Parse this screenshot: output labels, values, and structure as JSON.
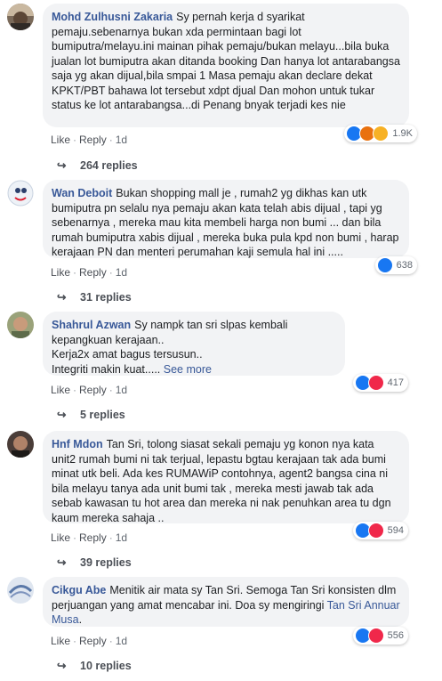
{
  "actions": {
    "like": "Like",
    "reply": "Reply",
    "time": "1d",
    "sep": "·"
  },
  "comments": [
    {
      "author": "Mohd Zulhusni Zakaria",
      "text": "Sy pernah kerja d syarikat pemaju.sebenarnya bukan xda permintaan bagi lot bumiputra/melayu.ini mainan pihak pemaju/bukan melayu...bila buka jualan lot bumiputra akan ditanda booking Dan hanya lot antarabangsa saja yg akan dijual,bila smpai 1 Masa pemaju akan declare dekat KPKT/PBT bahawa lot tersebut xdpt djual Dan mohon untuk tukar status ke lot antarabangsa...di Penang bnyak terjadi kes nie",
      "reactions": [
        "like-icon",
        "angry-icon",
        "wow-icon"
      ],
      "reaction_count": "1.9K",
      "replies": "264 replies"
    },
    {
      "author": "Wan Deboit",
      "text": "Bukan shopping mall je , rumah2 yg dikhas kan utk bumiputra pn selalu nya pemaju akan kata telah abis dijual , tapi yg sebenarnya , mereka mau kita membeli harga non bumi ... dan bila rumah bumiputra xabis dijual , mereka buka pula kpd non bumi , harap kerajaan PN dan menteri perumahan kaji semula hal ini .....",
      "reactions": [
        "like-icon"
      ],
      "reaction_count": "638",
      "replies": "31 replies"
    },
    {
      "author": "Shahrul Azwan",
      "text": "Sy nampk tan sri slpas kembali kepangkuan kerajaan..",
      "line2": "Kerja2x amat bagus tersusun..",
      "line3": "Integriti makin kuat.....",
      "see_more": "See more",
      "reactions": [
        "like-icon",
        "love-icon"
      ],
      "reaction_count": "417",
      "replies": "5 replies"
    },
    {
      "author": "Hnf Mdon",
      "text": "Tan Sri, tolong siasat sekali pemaju yg konon nya kata unit2 rumah bumi ni tak terjual, lepastu bgtau kerajaan tak ada bumi minat utk beli. Ada kes RUMAWiP contohnya, agent2 bangsa cina ni bila melayu tanya ada unit bumi tak , mereka mesti jawab tak ada sebab kawasan tu hot area dan mereka ni nak penuhkan area tu dgn kaum mereka sahaja ..",
      "reactions": [
        "like-icon",
        "love-icon"
      ],
      "reaction_count": "594",
      "replies": "39 replies"
    },
    {
      "author": "Cikgu Abe",
      "text": "Menitik air mata sy Tan Sri. Semoga Tan Sri konsisten dlm perjuangan yang amat mencabar ini. Doa sy mengiringi",
      "mention": "Tan Sri Annuar Musa",
      "mention_end": ".",
      "reactions": [
        "like-icon",
        "love-icon"
      ],
      "reaction_count": "556",
      "replies": "10 replies"
    }
  ]
}
